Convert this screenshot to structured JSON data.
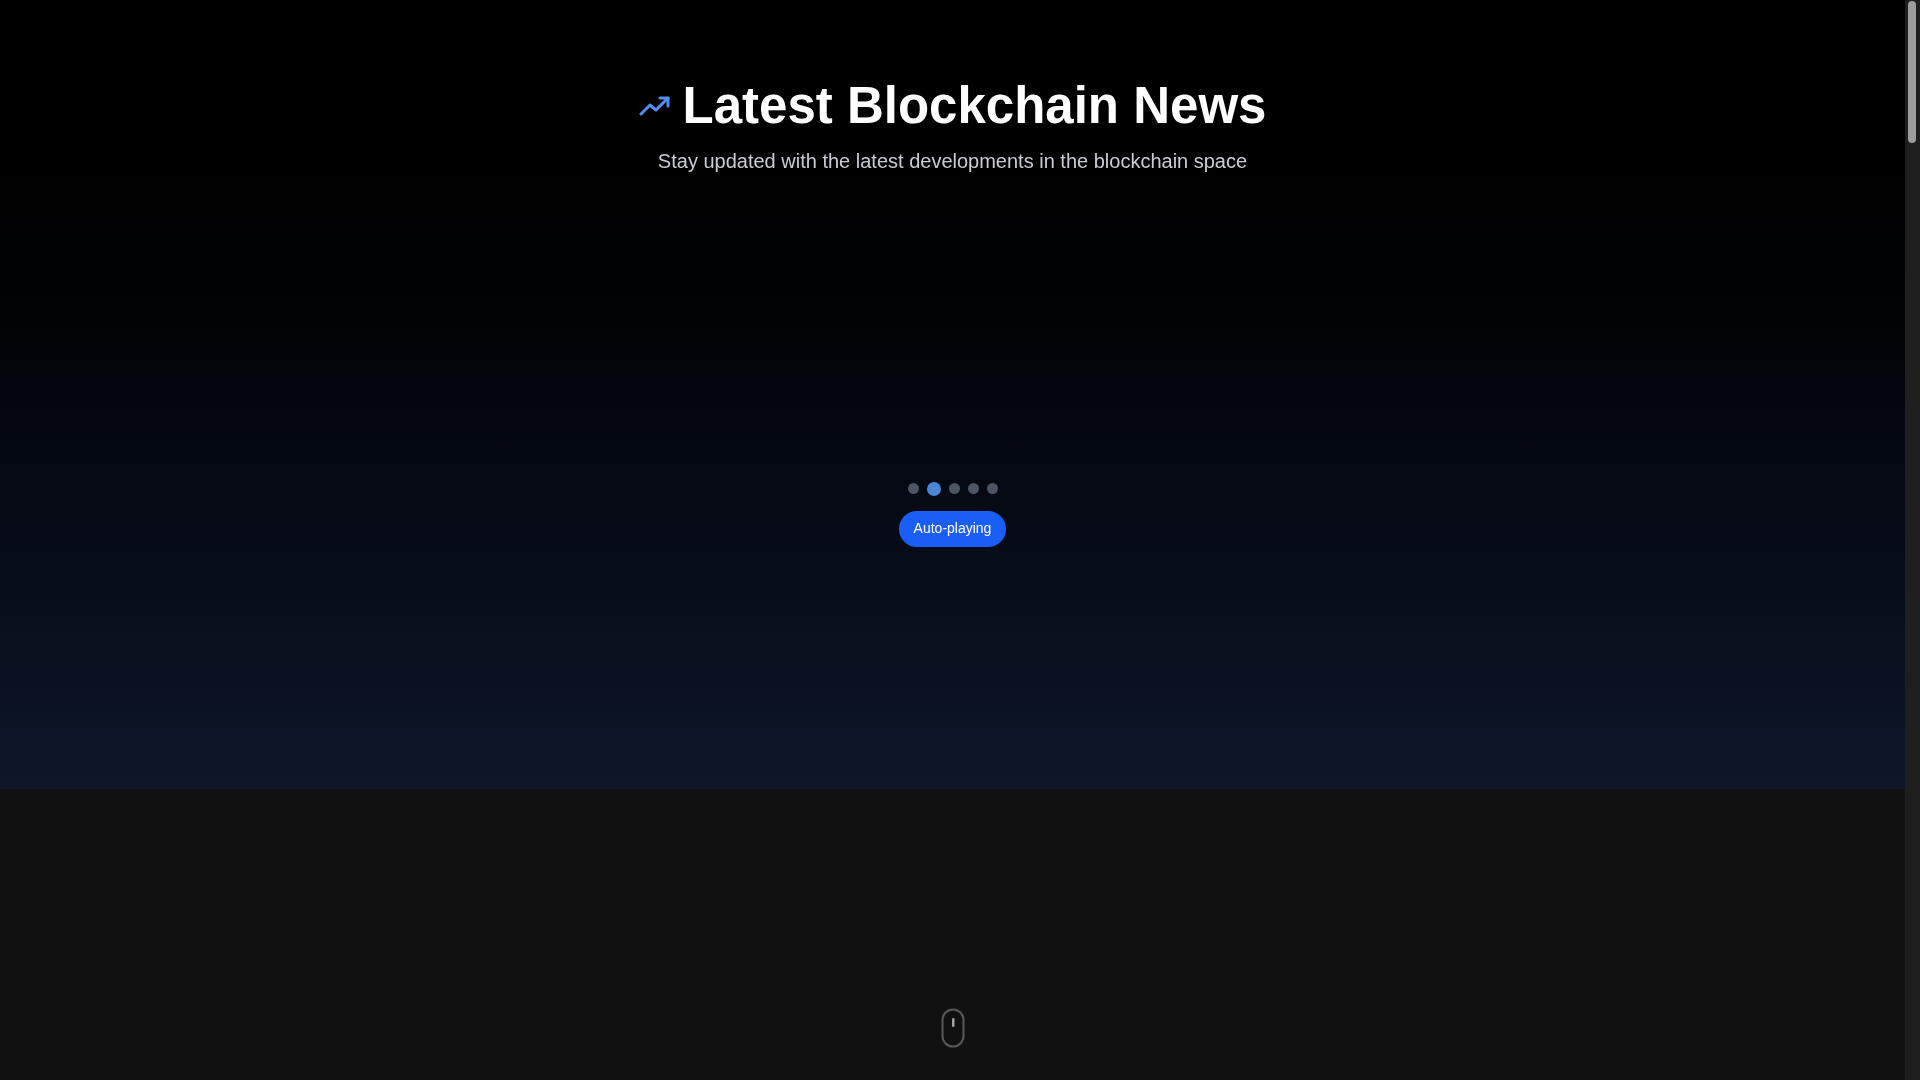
{
  "header": {
    "title": "Latest Blockchain News",
    "subtitle": "Stay updated with the latest developments in the blockchain space"
  },
  "carousel": {
    "dots": [
      {
        "selected": false
      },
      {
        "selected": true
      },
      {
        "selected": false
      },
      {
        "selected": false
      },
      {
        "selected": false
      }
    ],
    "autoplay_button": {
      "label": "Auto-playing",
      "on": true
    }
  }
}
